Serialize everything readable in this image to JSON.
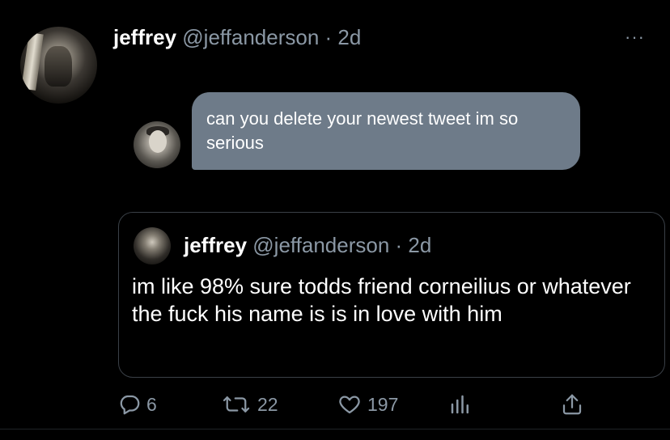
{
  "tweet": {
    "name": "jeffrey",
    "handle": "@jeffanderson",
    "time": "· 2d",
    "more": "···"
  },
  "reply": {
    "text": "can you delete your newest tweet im so serious"
  },
  "quoted": {
    "name": "jeffrey",
    "handle": "@jeffanderson",
    "time": "· 2d",
    "text": "im like 98% sure todds friend corneilius or whatever the fuck his name is is in love with him"
  },
  "actions": {
    "replies": "6",
    "retweets": "22",
    "likes": "197",
    "icons": [
      "reply-icon",
      "retweet-icon",
      "like-icon",
      "analytics-icon",
      "share-icon"
    ]
  },
  "colors": {
    "background": "#000000",
    "bubble": "#6e7b89",
    "muted": "#8b98a5"
  }
}
